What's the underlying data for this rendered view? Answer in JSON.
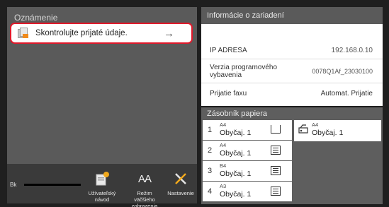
{
  "notifications": {
    "title": "Oznámenie",
    "item_text": "Skontrolujte prijaté údaje.",
    "arrow": "→"
  },
  "toolbar": {
    "toner_label": "Bk",
    "user_guide_label": "Užívateľský návod",
    "zoom_view_label": "Režim väčšieho zobrazenia",
    "settings_label": "Nastavenie",
    "zoom_glyph": "AA"
  },
  "device_info": {
    "title": "Informácie o zariadení",
    "rows": [
      {
        "key": "IP ADRESA",
        "value": "192.168.0.10"
      },
      {
        "key": "Verzia programového vybavenia",
        "value": "0078Q1Af_23030100"
      },
      {
        "key": "Prijatie faxu",
        "value": "Automat. Prijatie"
      }
    ]
  },
  "paper_tray": {
    "title": "Zásobník papiera",
    "trays": [
      {
        "number": "1",
        "size": "A4",
        "type": "Obyčaj. 1",
        "icon": "tray-empty-icon"
      },
      {
        "number": "2",
        "size": "A4",
        "type": "Obyčaj. 1",
        "icon": "tray-paper-icon"
      },
      {
        "number": "3",
        "size": "B4",
        "type": "Obyčaj. 1",
        "icon": "tray-paper-icon"
      },
      {
        "number": "4",
        "size": "A3",
        "type": "Obyčaj. 1",
        "icon": "tray-paper-icon"
      }
    ],
    "bypass": {
      "size": "A4",
      "type": "Obyčaj. 1",
      "icon": "bypass-tray-icon"
    }
  },
  "colors": {
    "highlight_border": "#e0192b",
    "panel_header": "#5a5a5a",
    "background": "#1f1f1f"
  }
}
